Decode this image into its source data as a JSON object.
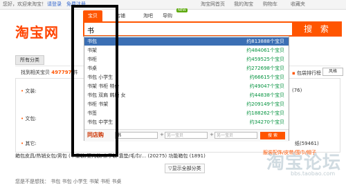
{
  "topbar": {
    "greeting": "您好，欢迎来淘宝！",
    "login": "请登录",
    "register": "免费注册",
    "home": "淘宝网首页",
    "my_taobao": "我的淘宝",
    "cart": "购物车",
    "favorites": "收藏夹"
  },
  "header": {
    "logo_text": "淘宝网",
    "search_tabs": [
      {
        "label": "宝贝",
        "active": true
      },
      {
        "label": "店铺",
        "active": false
      },
      {
        "label": "淘吧",
        "active": false
      },
      {
        "label": "导购",
        "active": false
      }
    ],
    "new_badge": "NEW",
    "search_value": "书",
    "search_button": "搜 索"
  },
  "suggestions": [
    {
      "keyword": "书包",
      "count": "约813888个宝贝",
      "highlighted": true
    },
    {
      "keyword": "书架",
      "count": "约484061个宝贝",
      "highlighted": false
    },
    {
      "keyword": "书柜",
      "count": "约459525个宝贝",
      "highlighted": false
    },
    {
      "keyword": "书桌",
      "count": "约272698个宝贝",
      "highlighted": false
    },
    {
      "keyword": "书包 小学生",
      "count": "约66615个宝贝",
      "highlighted": false
    },
    {
      "keyword": "书架 书柜 特价",
      "count": "约49047个宝贝",
      "highlighted": false
    },
    {
      "keyword": "书包 双肩 韩版 女",
      "count": "约44838个宝贝",
      "highlighted": false
    },
    {
      "keyword": "书柜 书架",
      "count": "约209149个宝贝",
      "highlighted": false
    },
    {
      "keyword": "书签",
      "count": "约188262个宝贝",
      "highlighted": false
    },
    {
      "keyword": "书包 中学生",
      "count": "约34270个宝贝",
      "highlighted": false
    }
  ],
  "dropdown_footer": {
    "logo": "同店购",
    "input1_value": "书",
    "input2_placeholder": "另一宝贝",
    "input3_placeholder": "另一宝贝",
    "search_button": "搜 索"
  },
  "content": {
    "all_categories": "所有分类",
    "found_text": "找到相关宝贝",
    "found_count": "497797",
    "found_suffix": "件",
    "rank_link": "包袋排行榜",
    "sort_label": "风格",
    "categories": [
      {
        "label": "文装:"
      },
      {
        "label": "文包:"
      },
      {
        "label": "其它:"
      }
    ],
    "right_snippets": {
      "row1": "(76)",
      "row3a": "纸(59461)",
      "row3b": "服装配饰/皮带/围巾/帽子"
    },
    "bottom_cat_line": "箱包皮具/热销女包/男包  (   ) 童装/婴儿装/亲子装  靠垫/毛巾/... (20275)  功能箱包 (1891)",
    "show_all": "显示全部分类",
    "bottom_row": "您是不是想找：  书包  书包 小学生  书架  书柜  书桌"
  },
  "watermark": {
    "main": "淘宝论坛",
    "sub": "bbs.taobao.com"
  },
  "colors": {
    "brand_orange": "#ff5500",
    "highlight_blue": "#3b6fb4",
    "count_green": "#00913c"
  }
}
